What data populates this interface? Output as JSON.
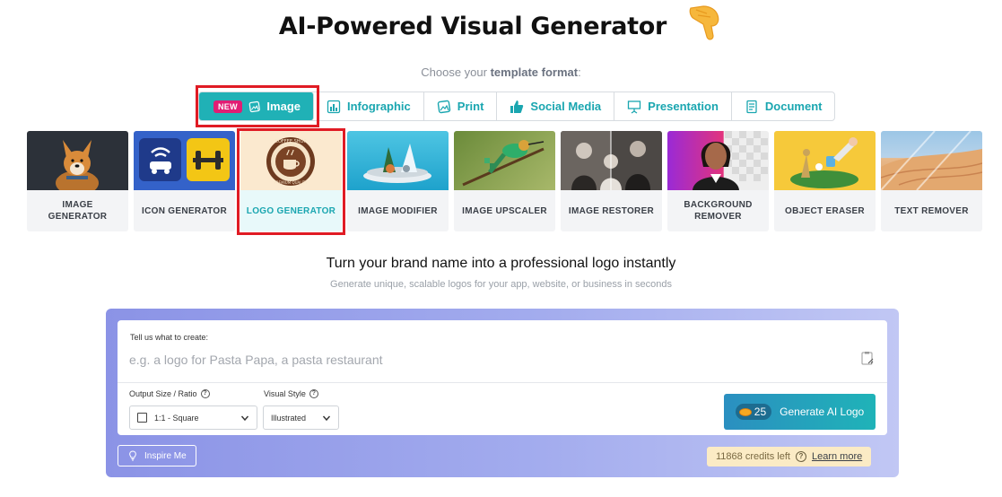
{
  "header": {
    "title": "AI-Powered Visual Generator",
    "hand_icon": "pointing-hand-icon"
  },
  "format": {
    "choose_prefix": "Choose your ",
    "choose_bold": "template format",
    "choose_suffix": ":",
    "tabs": [
      {
        "label": "Image",
        "badge": "NEW",
        "icon": "image-icon",
        "active": true
      },
      {
        "label": "Infographic",
        "icon": "bar-chart-icon"
      },
      {
        "label": "Print",
        "icon": "print-icon"
      },
      {
        "label": "Social Media",
        "icon": "thumbs-up-icon"
      },
      {
        "label": "Presentation",
        "icon": "presentation-icon"
      },
      {
        "label": "Document",
        "icon": "document-icon"
      }
    ]
  },
  "tools": [
    {
      "label": "IMAGE GENERATOR"
    },
    {
      "label": "ICON GENERATOR"
    },
    {
      "label": "LOGO GENERATOR",
      "selected": true
    },
    {
      "label": "IMAGE MODIFIER"
    },
    {
      "label": "IMAGE UPSCALER"
    },
    {
      "label": "IMAGE RESTORER"
    },
    {
      "label": "BACKGROUND REMOVER"
    },
    {
      "label": "OBJECT ERASER"
    },
    {
      "label": "TEXT REMOVER"
    }
  ],
  "logo_thumb": {
    "top_text": "COFFEE SHOP",
    "bottom_text": "PREMIUM QUALITY"
  },
  "intro": {
    "headline": "Turn your brand name into a professional logo instantly",
    "subline": "Generate unique, scalable logos for your app, website, or business in seconds"
  },
  "form": {
    "prompt_label": "Tell us what to create:",
    "prompt_placeholder": "e.g. a logo for Pasta Papa, a pasta restaurant",
    "size_label": "Output Size / Ratio",
    "size_value": "1:1 - Square",
    "style_label": "Visual Style",
    "style_value": "Illustrated",
    "help_glyph": "?",
    "generate_cost": "25",
    "generate_label": "Generate AI Logo",
    "inspire_label": "Inspire Me",
    "credits_text": "11868 credits left",
    "learn_more": "Learn more"
  },
  "colors": {
    "accent": "#20b1b6",
    "highlight": "#e01b24",
    "badge": "#e11d74"
  }
}
